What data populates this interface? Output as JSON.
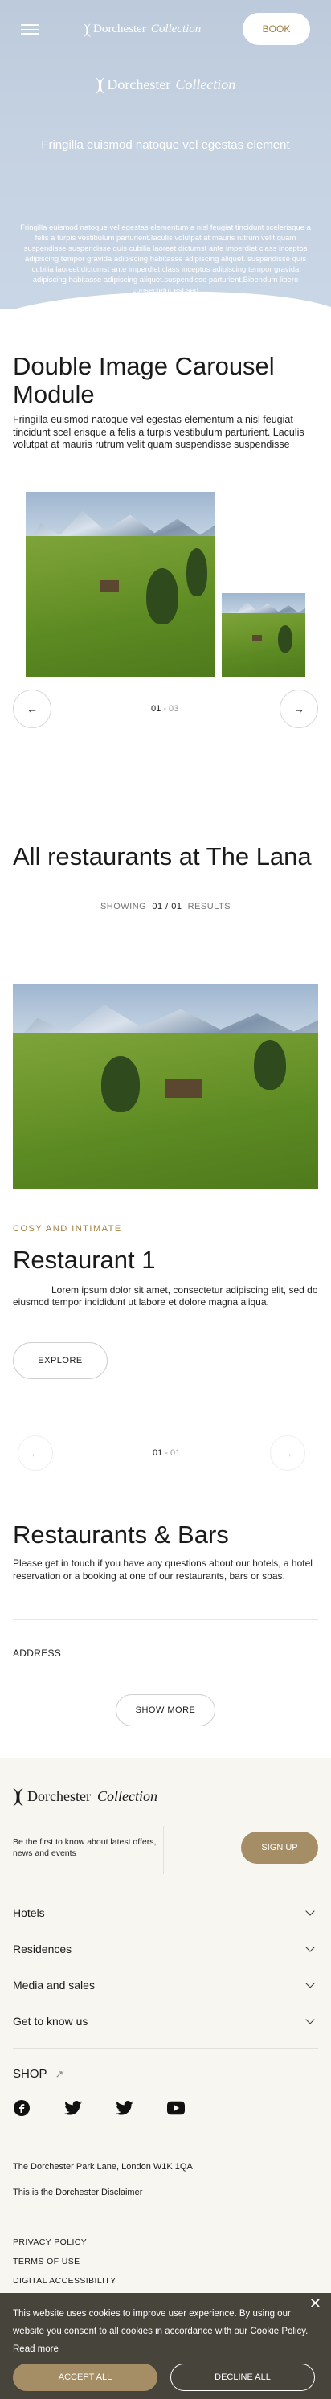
{
  "header": {
    "logo_word": "Dorchester",
    "logo_italic": "Collection",
    "book_label": "BOOK"
  },
  "hero": {
    "logo_word": "Dorchester",
    "logo_italic": "Collection",
    "subtitle": "Fringilla euismod natoque vel egestas element",
    "text": "Fringilla euismod natoque vel egestas elementum a nisl feugiat tincidunt scelerisque a felis a turpis vestibulum parturient.Iaculis volutpat at mauris rutrum velit quam suspendisse suspendisse quis cubilia laoreet dictumst ante imperdiet class inceptos adipiscing tempor gravida adipiscing habitasse adipiscing aliquet. suspendisse quis cubilia laoreet dictumst ante imperdiet class inceptos adipiscing tempor gravida adipiscing habitasse adipiscing aliquet.suspendisse parturient.Bibendum libero consectetur est sed"
  },
  "carousel": {
    "title": "Double Image Carousel Module",
    "text": "Fringilla euismod natoque vel egestas elementum a nisl feugiat tincidunt scel erisque a felis a turpis vestibulum parturient. Laculis volutpat at mauris rutrum velit quam suspendisse suspendisse",
    "current": "01",
    "total": "03",
    "separator": "-",
    "prev_icon": "arrow-left-icon",
    "next_icon": "arrow-right-icon"
  },
  "restaurants": {
    "title": "All restaurants at The Lana",
    "results_prefix": "SHOWING",
    "results_count": "01 / 01",
    "results_suffix": "RESULTS",
    "eyebrow": "COSY AND INTIMATE",
    "item_title": "Restaurant 1",
    "item_text": "Lorem ipsum dolor sit amet, consectetur adipiscing elit, sed do eiusmod tempor incididunt ut labore et dolore magna aliqua.",
    "explore_label": "EXPLORE",
    "current": "01",
    "total": "01",
    "separator": "-"
  },
  "bars": {
    "title": "Restaurants & Bars",
    "text": "Please get in touch if you have any questions about our hotels, a hotel reservation or a booking at one of our restaurants, bars or spas.",
    "address_label": "ADDRESS",
    "show_more_label": "SHOW MORE"
  },
  "footer": {
    "logo_word": "Dorchester",
    "logo_italic": "Collection",
    "newsletter": "Be the first to know about latest offers, news and events",
    "signup_label": "SIGN UP",
    "menu": [
      "Hotels",
      "Residences",
      "Media and sales",
      "Get to know us"
    ],
    "shop_label": "SHOP",
    "socials": [
      "facebook-icon",
      "twitter-icon",
      "twitter-icon",
      "youtube-icon"
    ],
    "address": "The Dorchester Park Lane, London W1K 1QA",
    "disclaimer": "This is the Dorchester Disclaimer",
    "legal": [
      "PRIVACY POLICY",
      "TERMS OF USE",
      "DIGITAL ACCESSIBILITY"
    ]
  },
  "cookie": {
    "text": "This website uses cookies to improve user experience. By using our website you consent to all cookies in accordance with our Cookie Policy.",
    "read_more": "Read more",
    "accept_label": "ACCEPT ALL",
    "decline_label": "DECLINE ALL"
  },
  "colors": {
    "accent_gold": "#a17c3e",
    "button_gold": "#a58e65",
    "hero_blue": "#c5d2e2",
    "footer_bg": "#f7f6f1",
    "cookie_bg": "#3c3830"
  }
}
